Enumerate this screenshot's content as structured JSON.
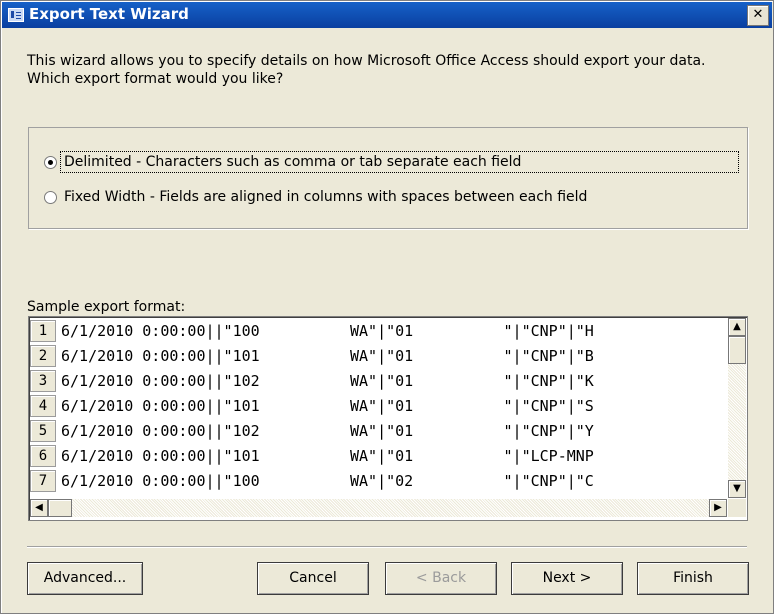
{
  "window": {
    "title": "Export Text Wizard"
  },
  "intro": "This wizard allows you to specify details on how Microsoft Office Access should export your data. Which export format would you like?",
  "options": {
    "delimited": {
      "label": "Delimited - Characters such as comma or tab separate each field",
      "selected": true
    },
    "fixed_width": {
      "label": "Fixed Width - Fields are aligned in columns with spaces between each field",
      "selected": false
    }
  },
  "sample": {
    "label": "Sample export format:",
    "rows": [
      {
        "num": "1",
        "text": "6/1/2010 0:00:00||\"100          WA\"|\"01          \"|\"CNP\"|\"H"
      },
      {
        "num": "2",
        "text": "6/1/2010 0:00:00||\"101          WA\"|\"01          \"|\"CNP\"|\"B"
      },
      {
        "num": "3",
        "text": "6/1/2010 0:00:00||\"102          WA\"|\"01          \"|\"CNP\"|\"K"
      },
      {
        "num": "4",
        "text": "6/1/2010 0:00:00||\"101          WA\"|\"01          \"|\"CNP\"|\"S"
      },
      {
        "num": "5",
        "text": "6/1/2010 0:00:00||\"102          WA\"|\"01          \"|\"CNP\"|\"Y"
      },
      {
        "num": "6",
        "text": "6/1/2010 0:00:00||\"101          WA\"|\"01          \"|\"LCP-MNP"
      },
      {
        "num": "7",
        "text": "6/1/2010 0:00:00||\"100          WA\"|\"02          \"|\"CNP\"|\"C"
      }
    ]
  },
  "buttons": {
    "advanced": "Advanced...",
    "cancel": "Cancel",
    "back": "< Back",
    "next": "Next >",
    "finish": "Finish"
  },
  "icons": {
    "window": "table-icon",
    "close": "close-icon",
    "scroll_up": "arrow-up-icon",
    "scroll_down": "arrow-down-icon",
    "scroll_left": "arrow-left-icon",
    "scroll_right": "arrow-right-icon"
  },
  "colors": {
    "titlebar": "#0a3fa0",
    "face": "#ece9d8"
  }
}
